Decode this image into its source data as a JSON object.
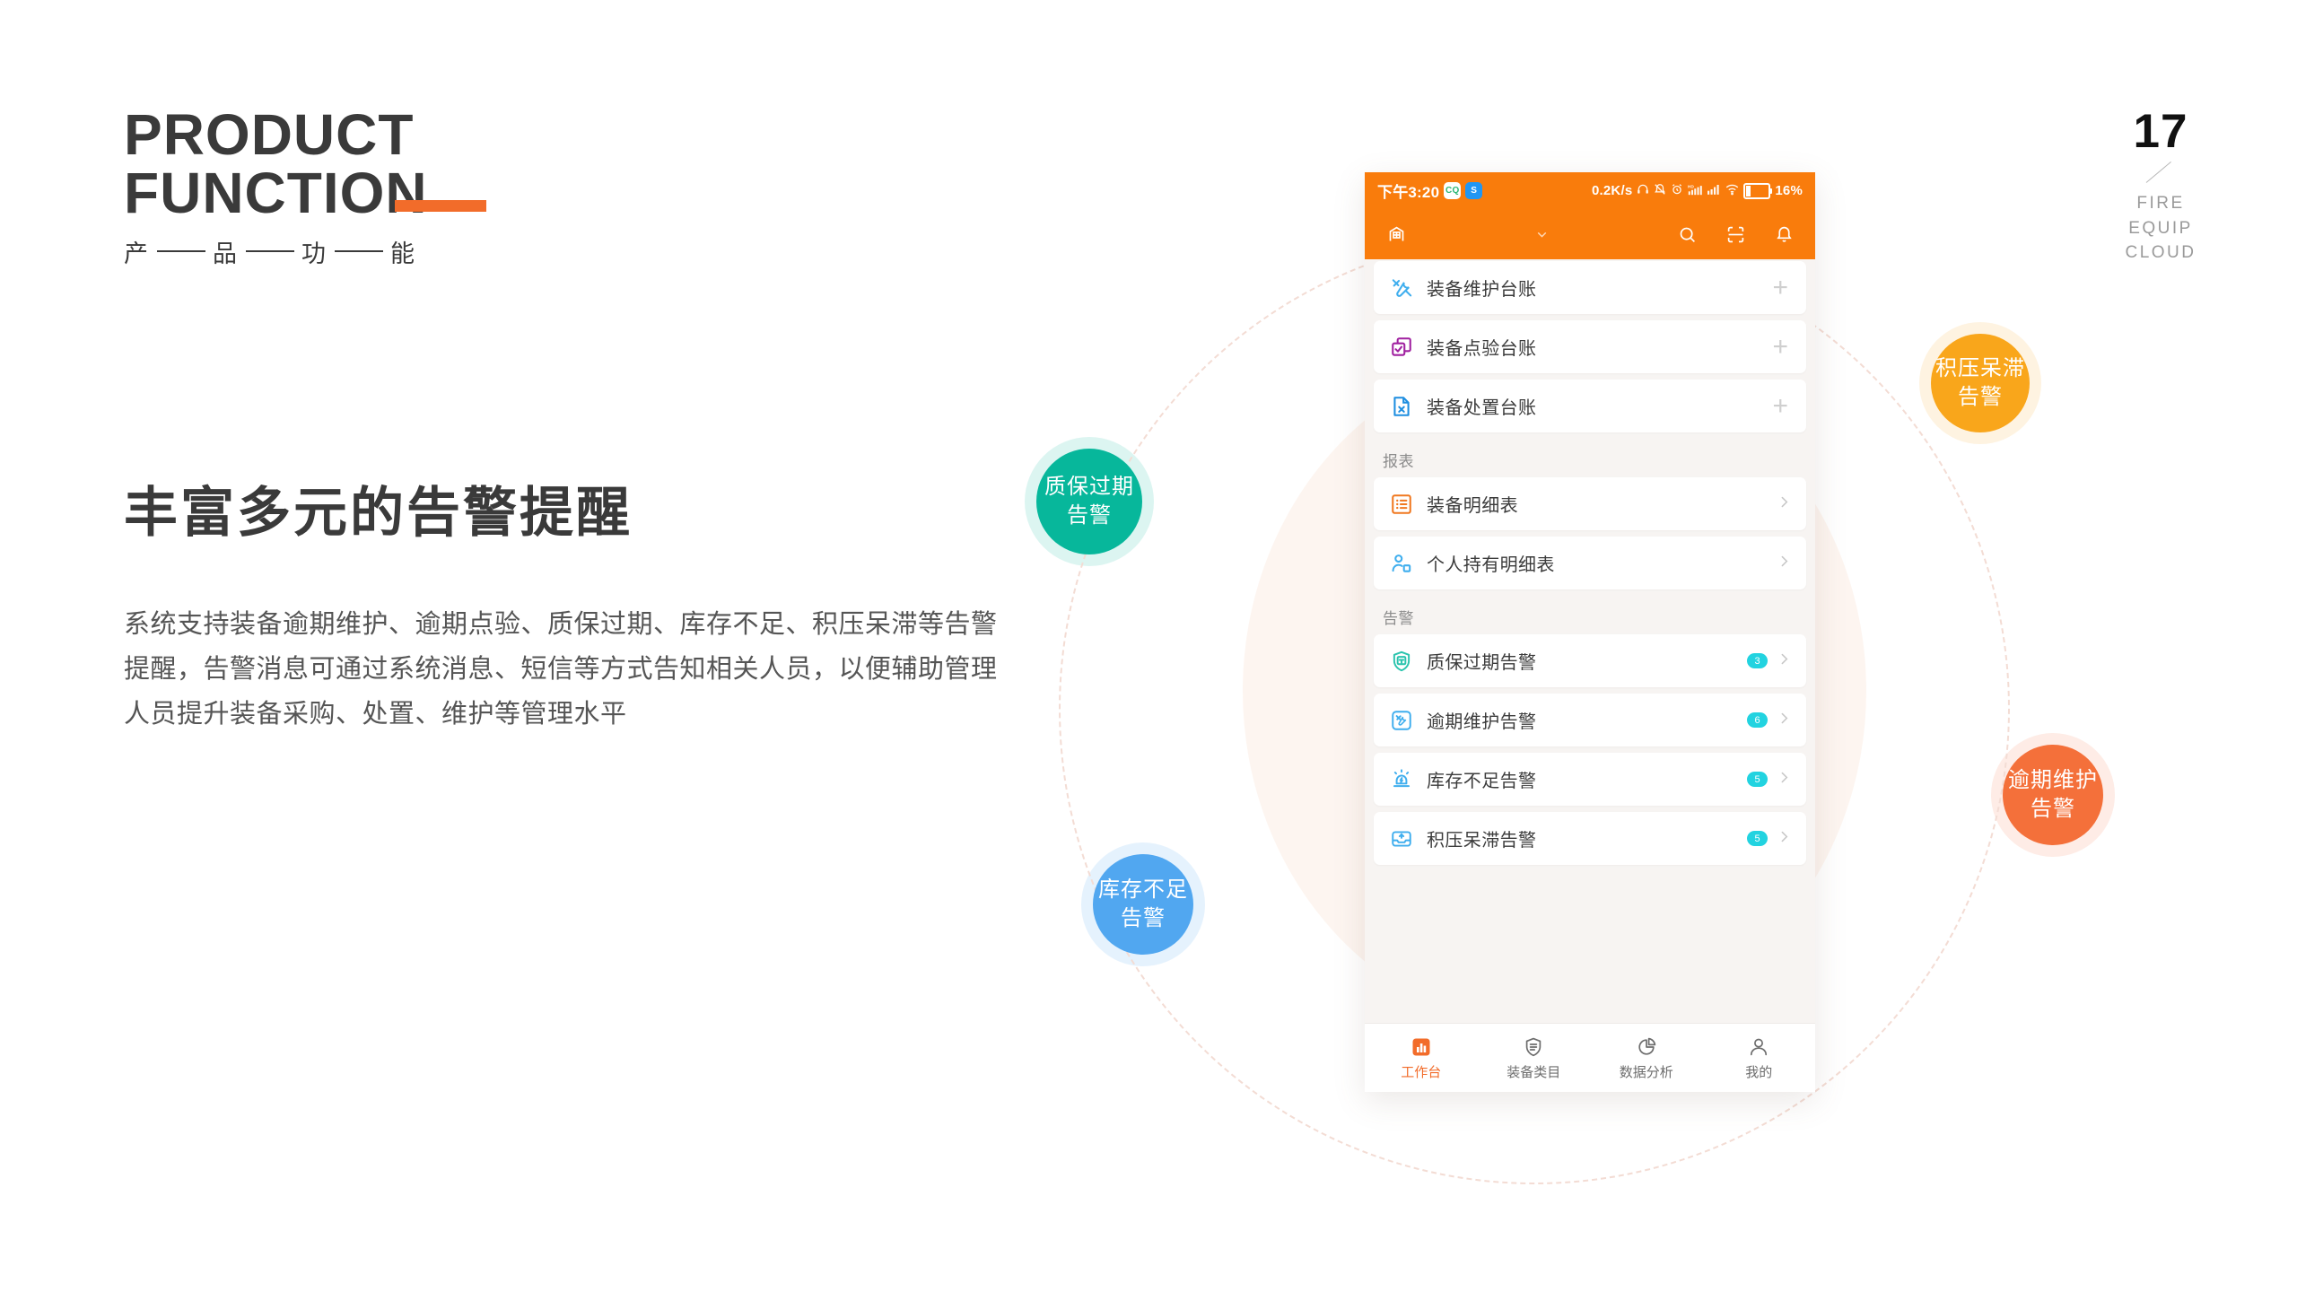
{
  "slide": {
    "kicker_line1": "PRODUCT",
    "kicker_line2": "FUNCTION",
    "kicker_cn": [
      "产",
      "品",
      "功",
      "能"
    ],
    "headline": "丰富多元的告警提醒",
    "body": "系统支持装备逾期维护、逾期点验、质保过期、库存不足、积压呆滞等告警提醒，告警消息可通过系统消息、短信等方式告知相关人员，以便辅助管理人员提升装备采购、处置、维护等管理水平",
    "page_number": "17",
    "page_label_lines": [
      "FIRE",
      "EQUIP",
      "CLOUD"
    ],
    "accent_color": "#f26c2a"
  },
  "bubbles": [
    {
      "name": "warranty-expired",
      "line1": "质保过期",
      "line2": "告警",
      "color": "#07b79b"
    },
    {
      "name": "overstock-idle",
      "line1": "积压呆滞",
      "line2": "告警",
      "color": "#f9a61b"
    },
    {
      "name": "low-stock",
      "line1": "库存不足",
      "line2": "告警",
      "color": "#51a7f0"
    },
    {
      "name": "overdue-maintain",
      "line1": "逾期维护",
      "line2": "告警",
      "color": "#f4703a"
    }
  ],
  "phone": {
    "statusbar": {
      "time": "下午3:20",
      "app_badge_1": "CQ",
      "app_badge_2": "S",
      "net_speed": "0.2K/s",
      "battery_percent": "16%"
    },
    "appbar": {
      "brand_icon": "building-icon",
      "dropdown_icon": "chevron-down-icon",
      "search_icon": "search-icon",
      "scan_icon": "scan-icon",
      "bell_icon": "bell-icon"
    },
    "sections": [
      {
        "title": "",
        "items": [
          {
            "label": "装备维护台账",
            "icon": "tools-icon",
            "icon_color": "#3faeee",
            "action": "plus",
            "badge": ""
          },
          {
            "label": "装备点验台账",
            "icon": "checkbox-copy-icon",
            "icon_color": "#a020a0",
            "action": "plus",
            "badge": ""
          },
          {
            "label": "装备处置台账",
            "icon": "file-x-icon",
            "icon_color": "#1e8ee0",
            "action": "plus",
            "badge": ""
          }
        ]
      },
      {
        "title": "报表",
        "items": [
          {
            "label": "装备明细表",
            "icon": "list-box-icon",
            "icon_color": "#f07820",
            "action": "chevron",
            "badge": ""
          },
          {
            "label": "个人持有明细表",
            "icon": "person-box-icon",
            "icon_color": "#3faeee",
            "action": "chevron",
            "badge": ""
          }
        ]
      },
      {
        "title": "告警",
        "items": [
          {
            "label": "质保过期告警",
            "icon": "shield-bao-icon",
            "icon_color": "#2bc4ae",
            "action": "chevron",
            "badge": "3"
          },
          {
            "label": "逾期维护告警",
            "icon": "tools-box-icon",
            "icon_color": "#3faeee",
            "action": "chevron",
            "badge": "6"
          },
          {
            "label": "库存不足告警",
            "icon": "siren-icon",
            "icon_color": "#3faeee",
            "action": "chevron",
            "badge": "5"
          },
          {
            "label": "积压呆滞告警",
            "icon": "inbox-icon",
            "icon_color": "#3faeee",
            "action": "chevron",
            "badge": "5"
          }
        ]
      }
    ],
    "tabbar": [
      {
        "label": "工作台",
        "icon": "bar-chart-icon",
        "active": true
      },
      {
        "label": "装备类目",
        "icon": "shield-list-icon",
        "active": false
      },
      {
        "label": "数据分析",
        "icon": "pie-chart-icon",
        "active": false
      },
      {
        "label": "我的",
        "icon": "person-icon",
        "active": false
      }
    ]
  }
}
